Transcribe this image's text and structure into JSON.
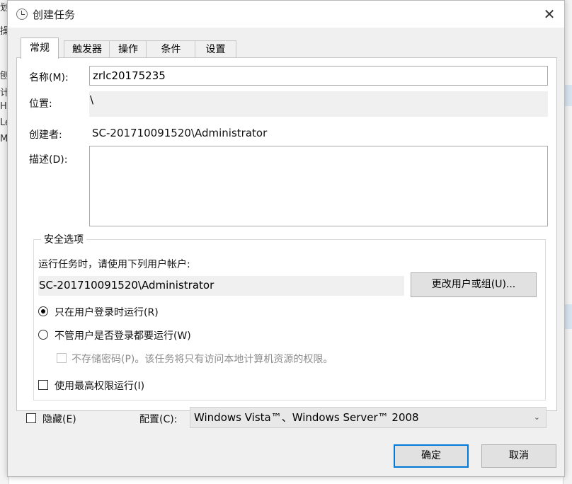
{
  "background": {
    "left_fragments": [
      "划",
      "操",
      "",
      "刨",
      "计",
      "HF",
      "Le",
      "Mi"
    ]
  },
  "window": {
    "title": "创建任务",
    "close_symbol": "✕"
  },
  "tabs": [
    {
      "label": "常规",
      "active": true
    },
    {
      "label": "触发器",
      "active": false
    },
    {
      "label": "操作",
      "active": false
    },
    {
      "label": "条件",
      "active": false
    },
    {
      "label": "设置",
      "active": false
    }
  ],
  "general": {
    "name_label": "名称(M):",
    "name_value": "zrlc20175235",
    "location_label": "位置:",
    "location_value": "\\",
    "author_label": "创建者:",
    "author_value": "SC-201710091520\\Administrator",
    "description_label": "描述(D):",
    "description_value": ""
  },
  "security": {
    "group_title": "安全选项",
    "run_as_prompt": "运行任务时，请使用下列用户帐户:",
    "account_value": "SC-201710091520\\Administrator",
    "change_user_button": "更改用户或组(U)...",
    "radio_logged_on": "只在用户登录时运行(R)",
    "radio_whether_logged_on": "不管用户是否登录都要运行(W)",
    "no_store_password": "不存储密码(P)。该任务将只有访问本地计算机资源的权限。",
    "highest_privileges": "使用最高权限运行(I)",
    "selected_radio": "logged_on"
  },
  "footer": {
    "hidden_label": "隐藏(E)",
    "configure_label": "配置(C):",
    "configure_value": "Windows Vista™、Windows Server™ 2008",
    "ok_button": "确定",
    "cancel_button": "取消"
  },
  "colors": {
    "accent": "#0078d7",
    "dialog_bg": "#f0f0f0",
    "readonly_bg": "#f0f0f0"
  }
}
